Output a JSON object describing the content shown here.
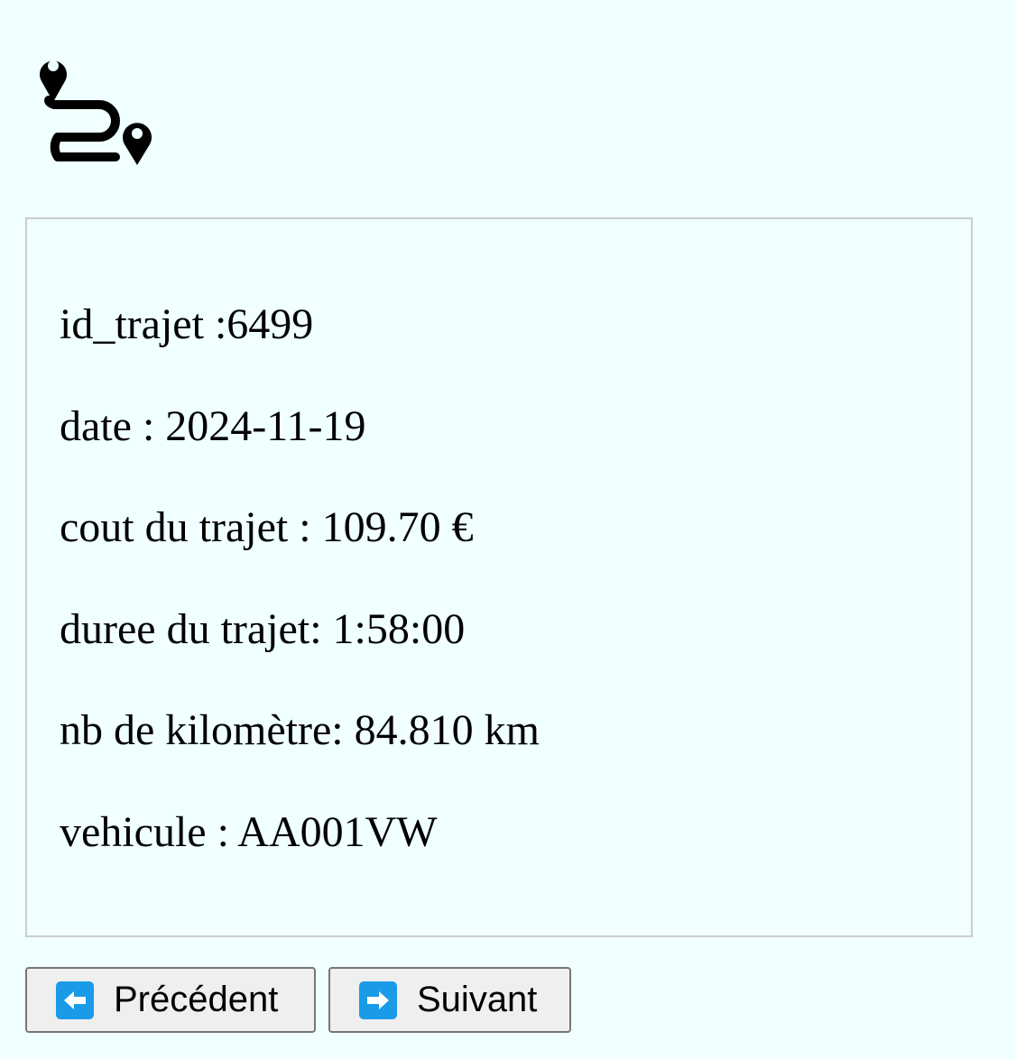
{
  "icons": {
    "route": "route-icon",
    "previous": "left-arrow-icon",
    "next": "right-arrow-icon"
  },
  "colors": {
    "page_background": "#f0ffff",
    "box_border": "#cccccc",
    "button_background": "#efefef",
    "button_border": "#767676",
    "arrow_icon_background": "#1a9be8"
  },
  "trajet": {
    "id_line": "id_trajet :6499",
    "date_line": "date : 2024-11-19",
    "cout_line": "cout du trajet : 109.70 €",
    "duree_line": "duree du trajet: 1:58:00",
    "km_line": "nb de kilomètre: 84.810 km",
    "vehicule_line": "vehicule : AA001VW"
  },
  "navigation": {
    "previous_label": "Précédent",
    "next_label": "Suivant"
  }
}
